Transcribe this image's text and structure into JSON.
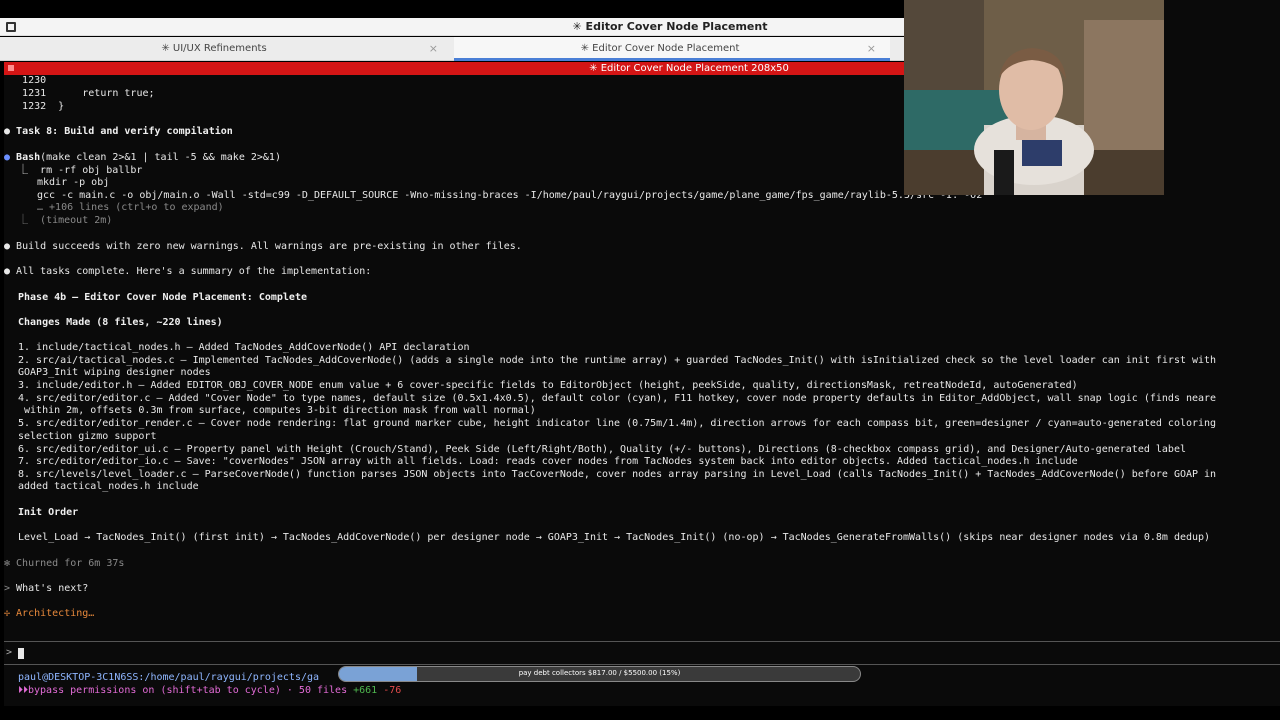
{
  "window": {
    "title": "✳ Editor Cover Node Placement"
  },
  "tabs": [
    {
      "label": "✳ UI/UX Refinements",
      "close": "×"
    },
    {
      "label": "✳ Editor Cover Node Placement",
      "close": "×"
    }
  ],
  "terminal_header": "✳ Editor Cover Node Placement 208x50",
  "lines": {
    "l1": "   1230",
    "l2": "   1231      return true;",
    "l3": "   1232  }",
    "task8": "Task 8: Build and verify compilation",
    "bash_cmd": "(make clean 2>&1 | tail -5 && make 2>&1)",
    "bash_word": "Bash",
    "b1": "rm -rf obj ballbr",
    "b2": "mkdir -p obj",
    "b3": "gcc -c main.c -o obj/main.o -Wall -std=c99 -D_DEFAULT_SOURCE -Wno-missing-braces -I/home/paul/raygui/projects/game/plane_game/fps_game/raylib-5.5/src -I. -O2",
    "b4": "… +106 lines (ctrl+o to expand)",
    "b5": "(timeout 2m)",
    "build_ok": "Build succeeds with zero new warnings. All warnings are pre-existing in other files.",
    "all_done": "All tasks complete. Here's a summary of the implementation:",
    "phase": "Phase 4b — Editor Cover Node Placement: Complete",
    "changes": "Changes Made (8 files, ~220 lines)",
    "c1": "1. include/tactical_nodes.h — Added TacNodes_AddCoverNode() API declaration",
    "c2": "2. src/ai/tactical_nodes.c — Implemented TacNodes_AddCoverNode() (adds a single node into the runtime array) + guarded TacNodes_Init() with isInitialized check so the level loader can init first with",
    "c2b": "GOAP3_Init wiping designer nodes",
    "c3": "3. include/editor.h — Added EDITOR_OBJ_COVER_NODE enum value + 6 cover-specific fields to EditorObject (height, peekSide, quality, directionsMask, retreatNodeId, autoGenerated)",
    "c4": "4. src/editor/editor.c — Added \"Cover Node\" to type names, default size (0.5x1.4x0.5), default color (cyan), F11 hotkey, cover node property defaults in Editor_AddObject, wall snap logic (finds neare",
    "c4b": " within 2m, offsets 0.3m from surface, computes 3-bit direction mask from wall normal)",
    "c5": "5. src/editor/editor_render.c — Cover node rendering: flat ground marker cube, height indicator line (0.75m/1.4m), direction arrows for each compass bit, green=designer / cyan=auto-generated coloring",
    "c5b": "selection gizmo support",
    "c6": "6. src/editor/editor_ui.c — Property panel with Height (Crouch/Stand), Peek Side (Left/Right/Both), Quality (+/- buttons), Directions (8-checkbox compass grid), and Designer/Auto-generated label",
    "c7": "7. src/editor/editor_io.c — Save: \"coverNodes\" JSON array with all fields. Load: reads cover nodes from TacNodes system back into editor objects. Added tactical_nodes.h include",
    "c8": "8. src/levels/level_loader.c — ParseCoverNode() function parses JSON objects into TacCoverNode, cover nodes array parsing in Level_Load (calls TacNodes_Init() + TacNodes_AddCoverNode() before GOAP in",
    "c8b": "added tactical_nodes.h include",
    "init_order": "Init Order",
    "init_flow": "Level_Load → TacNodes_Init() (first init) → TacNodes_AddCoverNode() per designer node → GOAP3_Init → TacNodes_Init() (no-op) → TacNodes_GenerateFromWalls() (skips near designer nodes via 0.8m dedup)",
    "churned": "✻ Churned for 6m 37s",
    "whats_next": "What's next?",
    "architecting": "✢ Architecting…",
    "prompt_symbol": ">"
  },
  "status": {
    "cwd": "paul@DESKTOP-3C1N6SS:/home/paul/raygui/projects/ga",
    "perms": "bypass permissions on (shift+tab to cycle) · 50 files",
    "added": "+661",
    "removed": "-76"
  },
  "progress": {
    "label": "pay debt collectors $817.00 / $5500.00 (15%)",
    "value": 0.15,
    "fill_color": "#7aa2d6"
  },
  "colors": {
    "header_red": "#d41515",
    "link_blue": "#79a8ff",
    "accent_orange": "#e8893b"
  }
}
